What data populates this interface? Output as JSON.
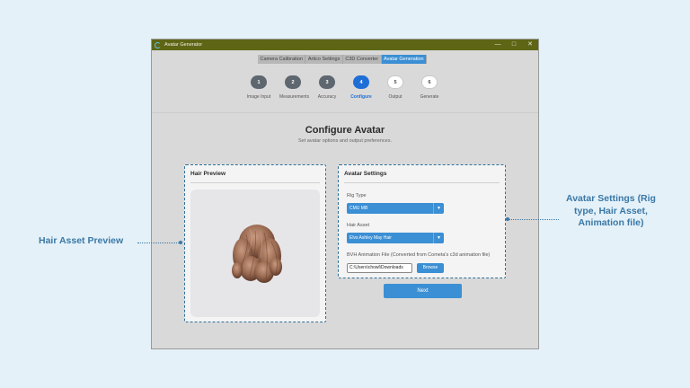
{
  "window": {
    "title": "Avatar Generator",
    "controls": {
      "minimize": "—",
      "maximize": "□",
      "close": "✕"
    }
  },
  "tabs": [
    {
      "label": "Camera Calibration"
    },
    {
      "label": "Artico Settings"
    },
    {
      "label": "C3D Converter"
    },
    {
      "label": "Avatar Generation",
      "active": true
    }
  ],
  "steps": [
    {
      "number": "1",
      "label": "Image Input",
      "state": "done"
    },
    {
      "number": "2",
      "label": "Measurements",
      "state": "done"
    },
    {
      "number": "3",
      "label": "Accuracy",
      "state": "done"
    },
    {
      "number": "4",
      "label": "Configure",
      "state": "current"
    },
    {
      "number": "5",
      "label": "Output",
      "state": "todo"
    },
    {
      "number": "6",
      "label": "Generate",
      "state": "todo"
    }
  ],
  "main": {
    "title": "Configure Avatar",
    "subtitle": "Set avatar options and output preferences."
  },
  "preview": {
    "title": "Hair Preview"
  },
  "settings": {
    "title": "Avatar Settings",
    "rig_type_label": "Rig Type",
    "rig_type_value": "CMU MB",
    "hair_asset_label": "Hair Asset",
    "hair_asset_value": "Elvs Ashley May Hair",
    "bvh_label": "BVH Animation File (Converted from Cometa's c3d animation file)",
    "bvh_value": "C:\\Users\\chowl\\Downloads",
    "browse_label": "Browse"
  },
  "next_label": "Next",
  "callouts": {
    "left": "Hair Asset Preview",
    "right": "Avatar Settings (Rig type, Hair Asset, Animation file)"
  },
  "colors": {
    "accent": "#3b8fd4",
    "current_step": "#1f6ed6",
    "titlebar": "#5e6616",
    "callout": "#3a78a6"
  }
}
